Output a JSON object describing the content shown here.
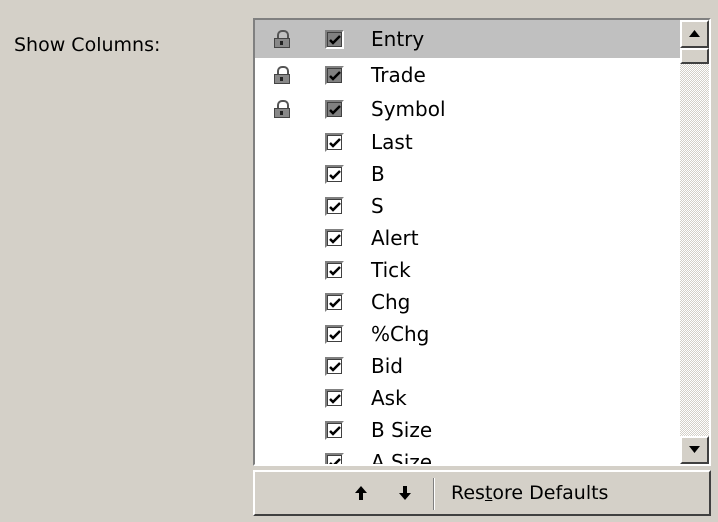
{
  "label": "Show Columns:",
  "columns": [
    {
      "name": "Entry",
      "locked": true,
      "checked": true,
      "disabled": true,
      "selected": true
    },
    {
      "name": "Trade",
      "locked": true,
      "checked": true,
      "disabled": true,
      "selected": false
    },
    {
      "name": "Symbol",
      "locked": true,
      "checked": true,
      "disabled": true,
      "selected": false
    },
    {
      "name": "Last",
      "locked": false,
      "checked": true,
      "disabled": false,
      "selected": false
    },
    {
      "name": "B",
      "locked": false,
      "checked": true,
      "disabled": false,
      "selected": false
    },
    {
      "name": "S",
      "locked": false,
      "checked": true,
      "disabled": false,
      "selected": false
    },
    {
      "name": "Alert",
      "locked": false,
      "checked": true,
      "disabled": false,
      "selected": false
    },
    {
      "name": "Tick",
      "locked": false,
      "checked": true,
      "disabled": false,
      "selected": false
    },
    {
      "name": "Chg",
      "locked": false,
      "checked": true,
      "disabled": false,
      "selected": false
    },
    {
      "name": "%Chg",
      "locked": false,
      "checked": true,
      "disabled": false,
      "selected": false
    },
    {
      "name": "Bid",
      "locked": false,
      "checked": true,
      "disabled": false,
      "selected": false
    },
    {
      "name": "Ask",
      "locked": false,
      "checked": true,
      "disabled": false,
      "selected": false
    },
    {
      "name": "B Size",
      "locked": false,
      "checked": true,
      "disabled": false,
      "selected": false
    },
    {
      "name": "A Size",
      "locked": false,
      "checked": true,
      "disabled": false,
      "selected": false
    }
  ],
  "toolbar": {
    "move_up_icon": "arrow-up-icon",
    "move_down_icon": "arrow-down-icon",
    "restore_pre": "Res",
    "restore_accel": "t",
    "restore_post": "ore Defaults"
  },
  "colors": {
    "background": "#d4d0c8",
    "selected_row": "#c0c0c0",
    "list_bg": "#ffffff"
  }
}
